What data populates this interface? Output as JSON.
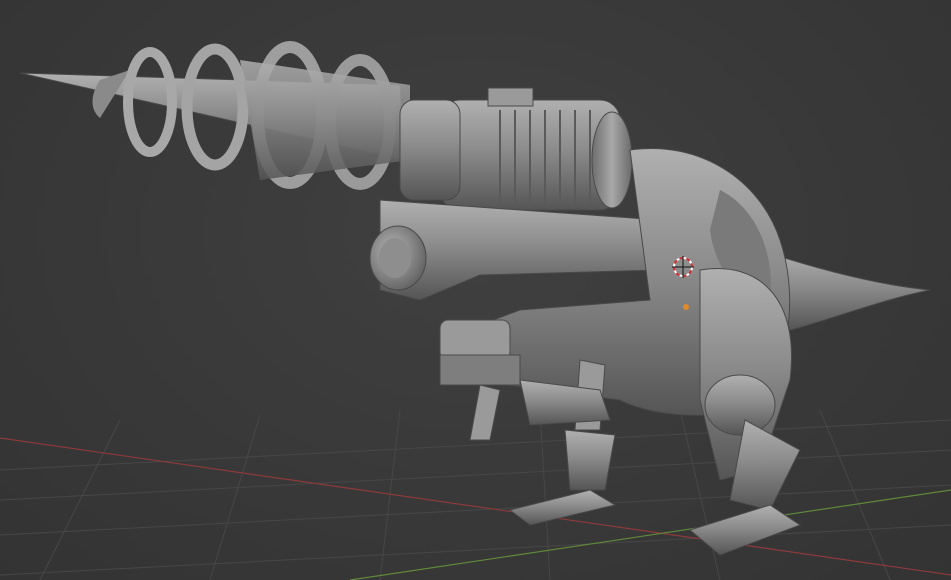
{
  "viewport": {
    "background_color": "#3a3a3a",
    "grid_color": "#4a4a4a",
    "x_axis_color": "#9a3a3a",
    "y_axis_color": "#6a9a3a"
  },
  "model": {
    "material_color": "#8a8a8a",
    "shadow_color": "#4e4e4e",
    "highlight_color": "#b4b4b4"
  },
  "overlays": {
    "cursor_3d": "3d-cursor-icon",
    "origin_color": "#e08a2a",
    "cursor_color": "#d03030"
  }
}
